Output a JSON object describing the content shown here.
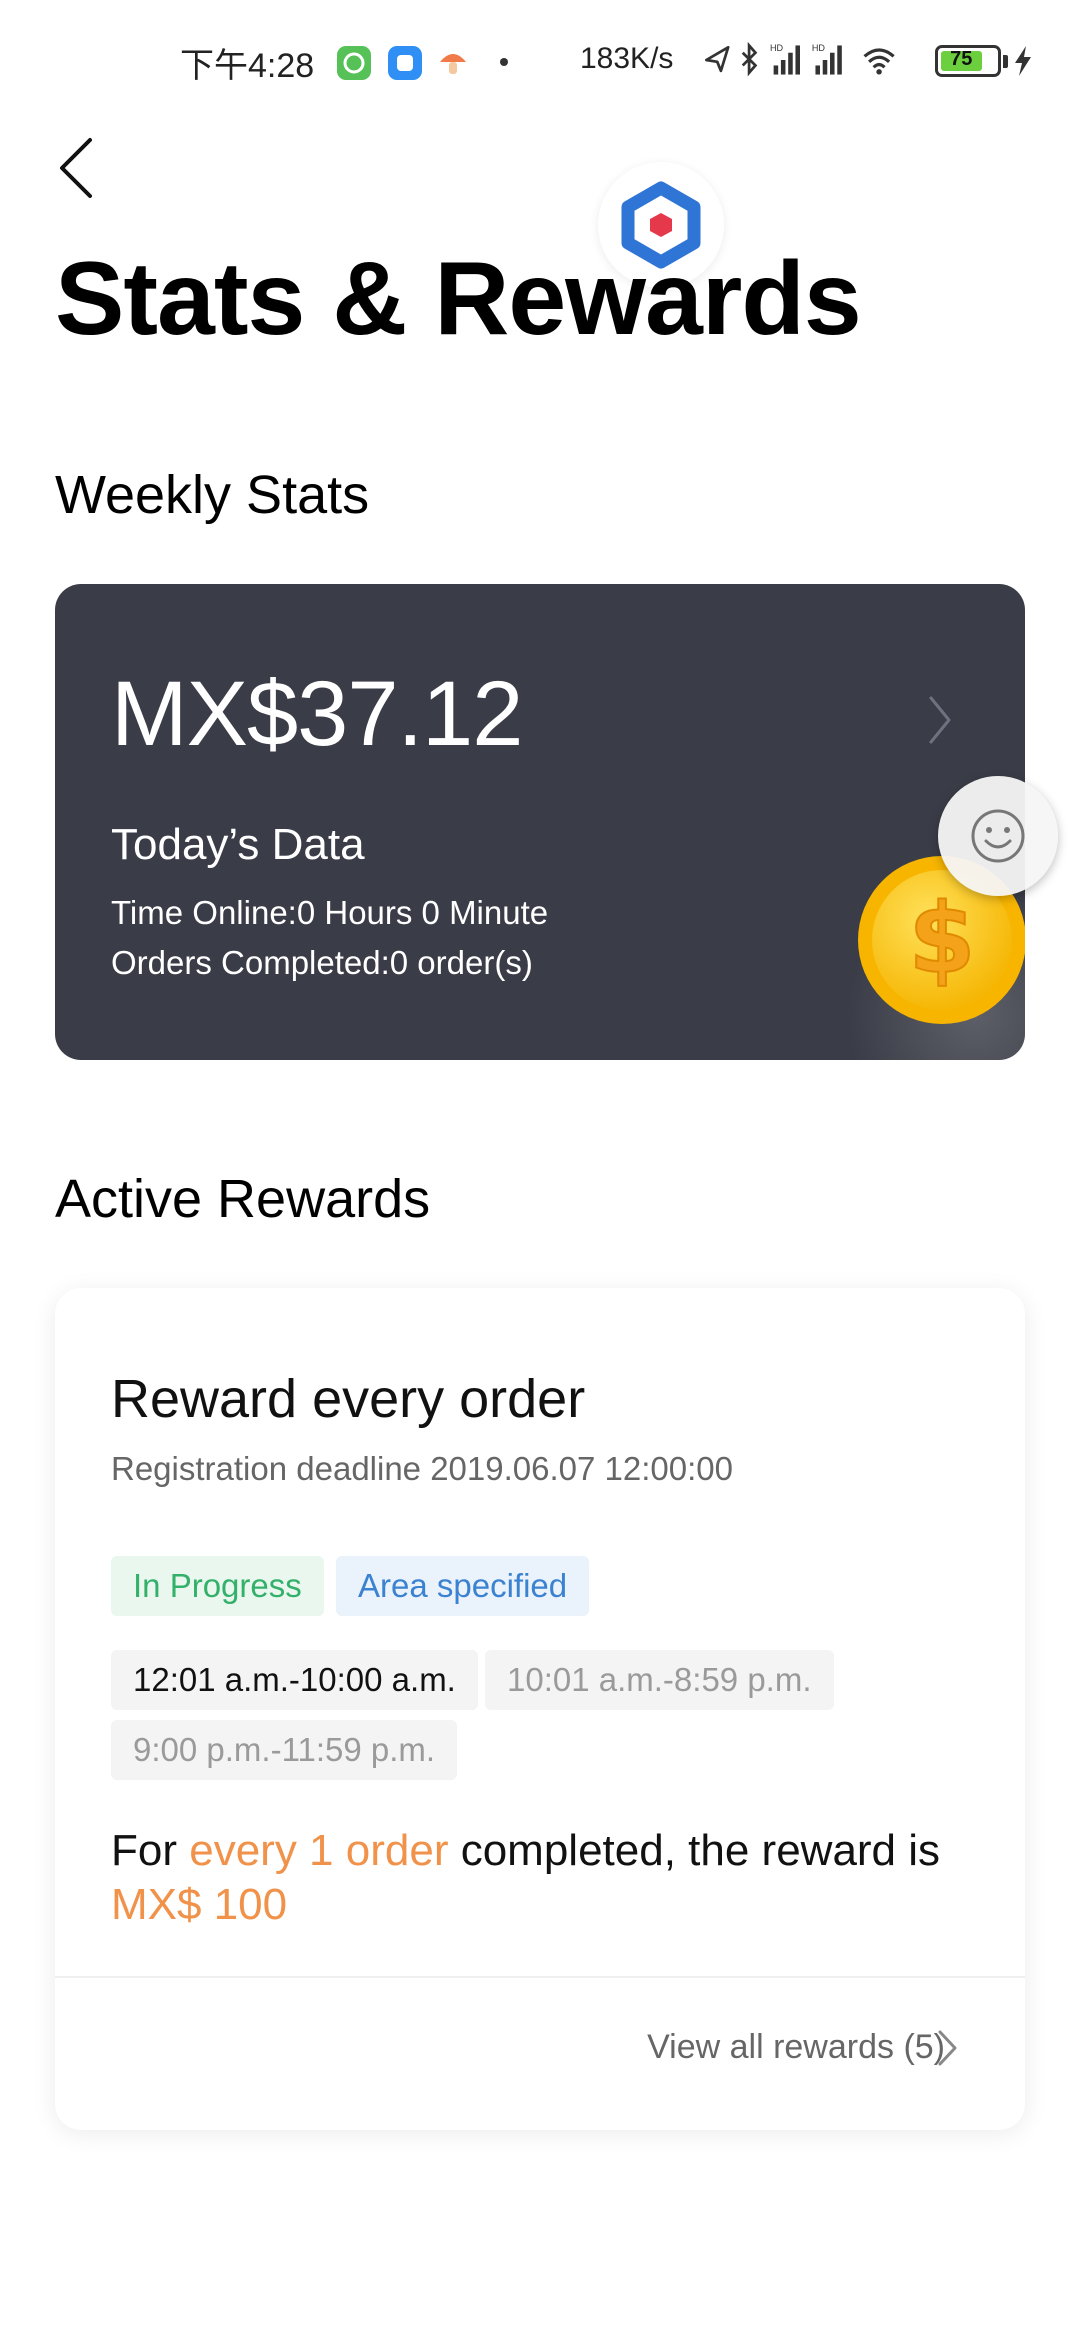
{
  "status_bar": {
    "time": "下午4:28",
    "network_speed": "183K/s",
    "battery": "75",
    "icons": [
      "app-green-icon",
      "app-blue-icon",
      "app-mushroom-icon",
      "location-icon",
      "bluetooth-icon",
      "signal-hd-icon",
      "signal-hd-icon",
      "wifi-icon",
      "battery-icon",
      "charging-icon"
    ]
  },
  "header": {
    "title": "Stats & Rewards",
    "back_icon": "chevron-left-icon",
    "badge_icon": "hexagon-logo-icon"
  },
  "weekly_stats": {
    "section_title": "Weekly Stats",
    "amount": "MX$37.12",
    "today_label": "Today’s Data",
    "time_online": "Time Online:0 Hours 0 Minute",
    "orders_completed": "Orders Completed:0 order(s)"
  },
  "active_rewards": {
    "section_title": "Active Rewards",
    "reward": {
      "name": "Reward every order",
      "deadline": "Registration deadline 2019.06.07 12:00:00",
      "status_tag": "In Progress",
      "area_tag": "Area specified",
      "time_slots": [
        "12:01 a.m.-10:00 a.m.",
        "10:01 a.m.-8:59 p.m.",
        "9:00 p.m.-11:59 p.m."
      ],
      "desc_prefix": "For ",
      "desc_highlight": "every 1 order",
      "desc_middle": " completed, the reward is",
      "desc_amount": "MX$ 100"
    },
    "view_all": "View all rewards (5)"
  },
  "colors": {
    "card_dark": "#3a3c47",
    "accent_orange": "#f0924a",
    "tag_green": "#33b06a",
    "tag_blue": "#3b82d1"
  }
}
